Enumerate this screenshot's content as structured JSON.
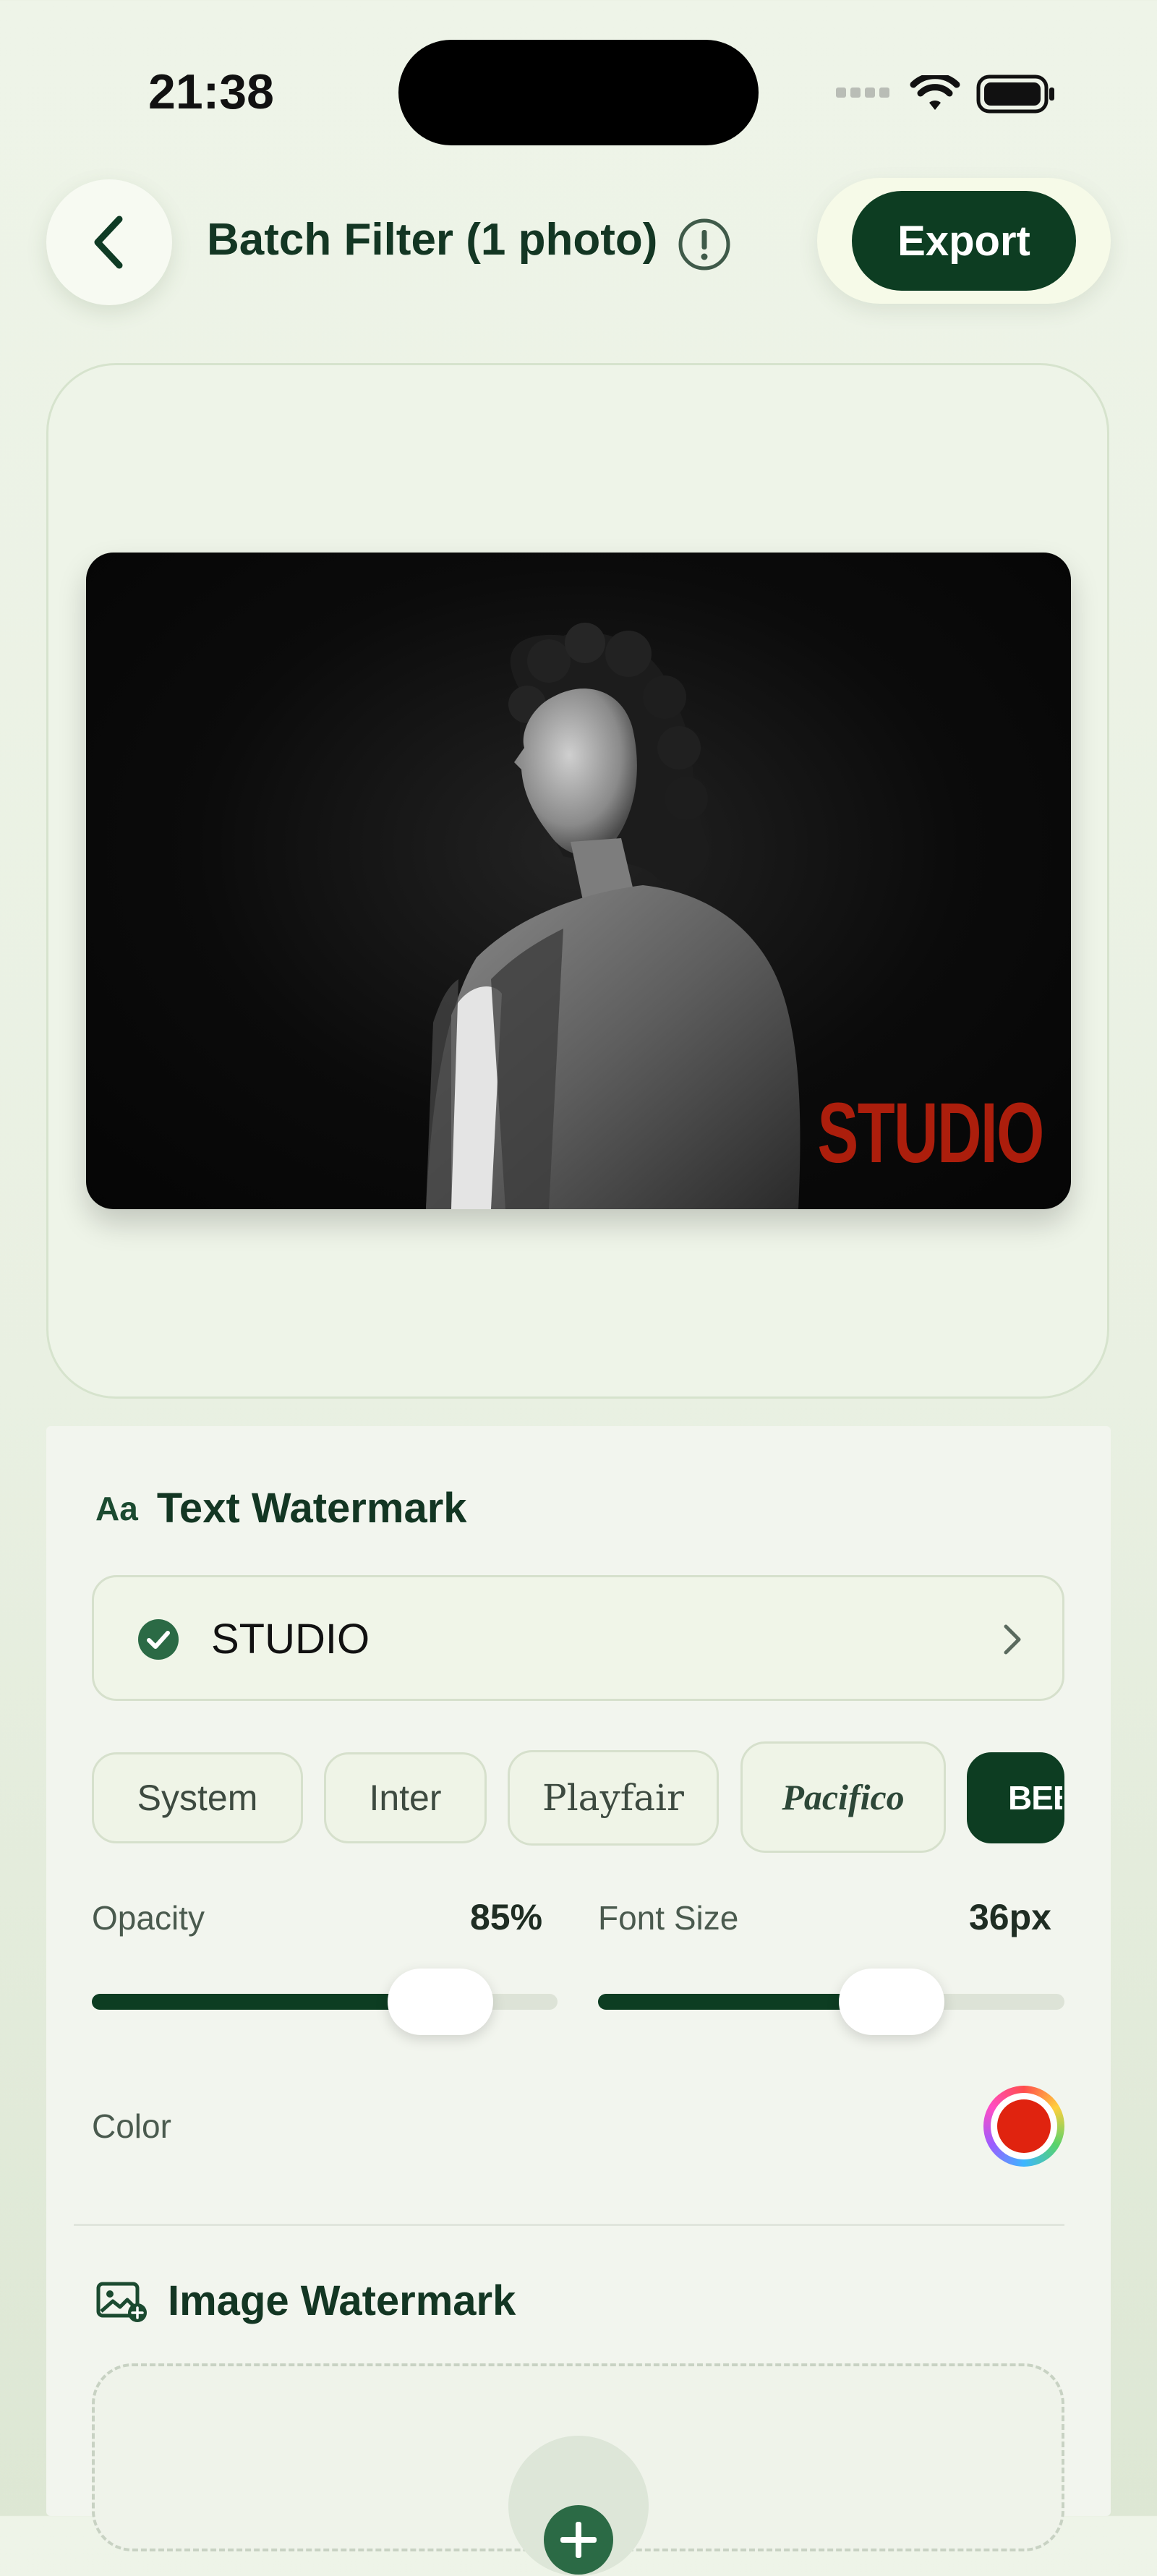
{
  "status_bar": {
    "time": "21:38"
  },
  "header": {
    "title": "Batch Filter (1 photo)",
    "export_label": "Export"
  },
  "preview": {
    "watermark_text": "STUDIO",
    "watermark_color": "#c9220d"
  },
  "text_watermark": {
    "section_title": "Text Watermark",
    "icon_text": "Aa",
    "text_value": "STUDIO",
    "fonts": [
      {
        "label": "System",
        "selected": false
      },
      {
        "label": "Inter",
        "selected": false
      },
      {
        "label": "Playfair",
        "selected": false
      },
      {
        "label": "Pacifico",
        "selected": false
      },
      {
        "label": "BEBAS",
        "selected": true
      }
    ],
    "opacity": {
      "label": "Opacity",
      "value_text": "85%",
      "value": 0.85
    },
    "font_size": {
      "label": "Font Size",
      "value_text": "36px",
      "value": 36,
      "fill_fraction": 0.63
    },
    "color": {
      "label": "Color",
      "value": "#e0230f"
    }
  },
  "image_watermark": {
    "section_title": "Image Watermark"
  },
  "colors": {
    "accent": "#0d3d22",
    "watermark_red": "#e0230f"
  }
}
